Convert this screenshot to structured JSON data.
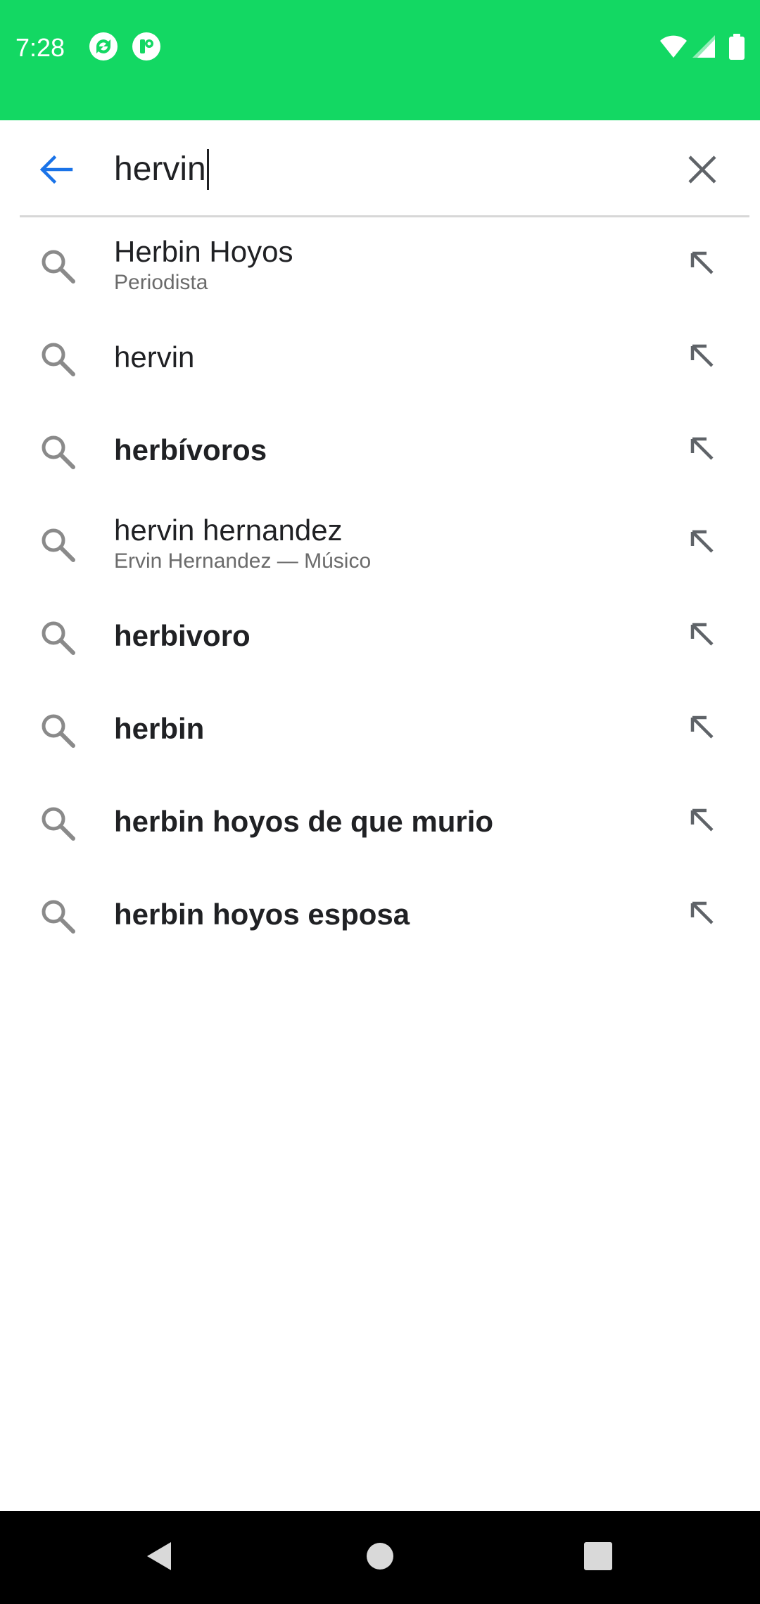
{
  "status_bar": {
    "time": "7:28",
    "background_color": "#13d863",
    "left_icons": [
      "sync-app-icon",
      "notification-app-icon"
    ],
    "right_icons": [
      "wifi-icon",
      "cell-signal-icon",
      "battery-icon"
    ]
  },
  "search": {
    "query": "hervin",
    "back_icon": "arrow-left-icon",
    "clear_icon": "close-icon",
    "accent_color": "#1a73e8"
  },
  "suggestions": [
    {
      "title": "Herbin Hoyos",
      "subtitle": "Periodista",
      "bold": false
    },
    {
      "title": "hervin",
      "subtitle": "",
      "bold": false
    },
    {
      "title": "herbívoros",
      "subtitle": "",
      "bold": true
    },
    {
      "title": "hervin hernandez",
      "subtitle": "Ervin Hernandez — Músico",
      "bold": false
    },
    {
      "title": "herbivoro",
      "subtitle": "",
      "bold": true
    },
    {
      "title": "herbin",
      "subtitle": "",
      "bold": true
    },
    {
      "title": "herbin hoyos de que murio",
      "subtitle": "",
      "bold": true
    },
    {
      "title": "herbin hoyos esposa",
      "subtitle": "",
      "bold": true
    }
  ],
  "nav_bar": {
    "buttons": [
      "back-triangle-icon",
      "home-circle-icon",
      "recents-square-icon"
    ]
  }
}
